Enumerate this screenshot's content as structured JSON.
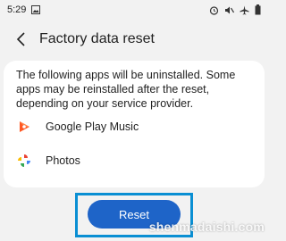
{
  "status_bar": {
    "time": "5:29",
    "left_icons": [
      "image-icon"
    ],
    "right_icons": [
      "alarm-icon",
      "mute-icon",
      "airplane-mode-icon",
      "battery-icon"
    ]
  },
  "header": {
    "title": "Factory data reset",
    "back_icon": "back-arrow-icon"
  },
  "card": {
    "description": "The following apps will be uninstalled. Some apps may be reinstalled after the reset, depending on your service provider.",
    "apps": [
      {
        "label": "Google Play Music",
        "icon": "google-play-music-icon"
      },
      {
        "label": "Photos",
        "icon": "google-photos-icon"
      }
    ]
  },
  "action": {
    "reset_label": "Reset",
    "highlight_color": "#0a8fd3",
    "button_color": "#1e64c8"
  },
  "watermark": {
    "text": "shenmadaishi.com"
  }
}
